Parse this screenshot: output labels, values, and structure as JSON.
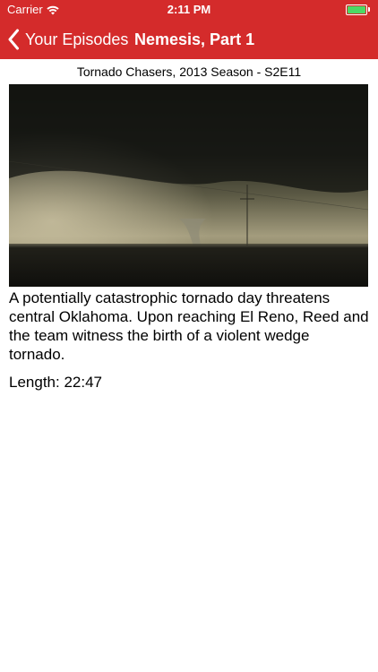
{
  "status": {
    "carrier": "Carrier",
    "time": "2:11 PM"
  },
  "nav": {
    "back_label": "Your Episodes",
    "title": "Nemesis, Part 1"
  },
  "episode": {
    "subtitle": "Tornado Chasers, 2013 Season - S2E11",
    "description": "A potentially catastrophic tornado day threatens central Oklahoma. Upon reaching El Reno, Reed and the team witness the birth of a violent wedge tornado.",
    "length": "Length: 22:47"
  },
  "colors": {
    "accent": "#d42b2b",
    "battery": "#4cd964"
  },
  "icons": {
    "wifi": "wifi-icon",
    "battery": "battery-icon",
    "back": "chevron-left-icon"
  }
}
